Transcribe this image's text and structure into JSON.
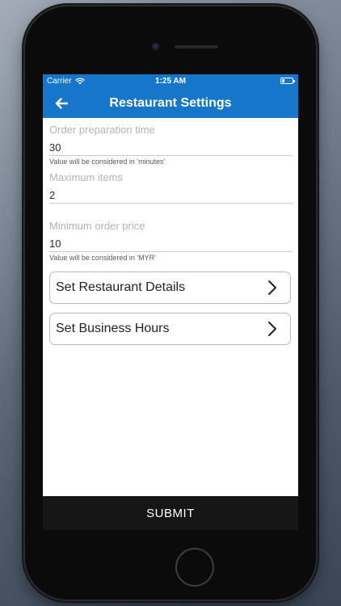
{
  "status_bar": {
    "carrier": "Carrier",
    "time": "1:25 AM"
  },
  "nav": {
    "title": "Restaurant Settings"
  },
  "fields": {
    "prep_time": {
      "label": "Order preparation time",
      "value": "30",
      "hint": "Value will be considered in 'minutes'"
    },
    "max_items": {
      "label": "Maximum items",
      "value": "2"
    },
    "min_price": {
      "label": "Minimum order price",
      "value": "10",
      "hint": "Value will be considered in 'MYR'"
    }
  },
  "menu": {
    "restaurant_details": "Set Restaurant Details",
    "business_hours": "Set Business Hours"
  },
  "submit_label": "SUBMIT",
  "colors": {
    "accent": "#1676c9",
    "submit_bar": "#161616"
  }
}
